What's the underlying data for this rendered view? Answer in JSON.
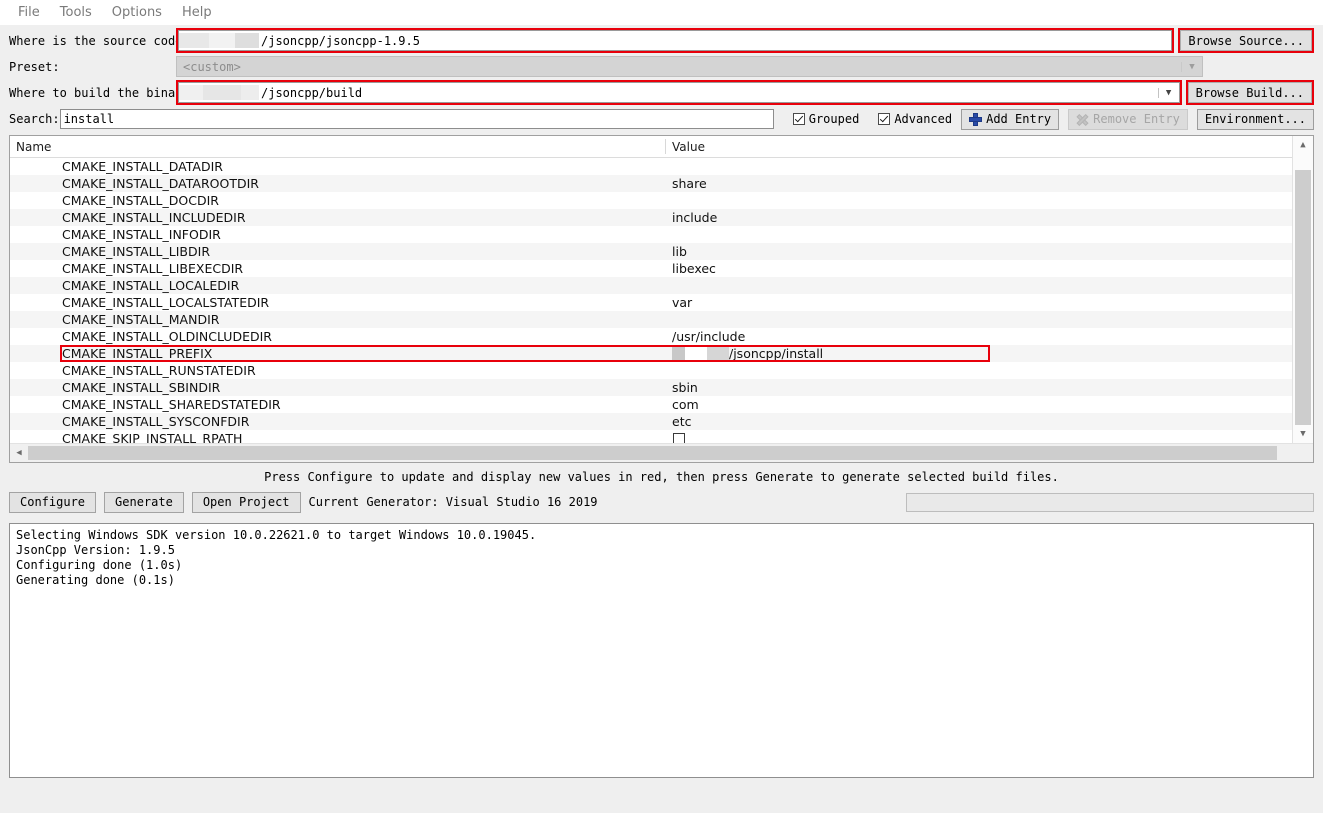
{
  "menubar": {
    "items": [
      {
        "label": "File"
      },
      {
        "label": "Tools"
      },
      {
        "label": "Options"
      },
      {
        "label": "Help"
      }
    ]
  },
  "form": {
    "source_label": "Where is the source code:",
    "source_value": "/jsoncpp/jsoncpp-1.9.5",
    "browse_source_label": "Browse Source...",
    "preset_label": "Preset:",
    "preset_value": "<custom>",
    "build_label": "Where to build the binaries:",
    "build_value": "/jsoncpp/build",
    "browse_build_label": "Browse Build..."
  },
  "search": {
    "label": "Search:",
    "value": "install",
    "placeholder": "",
    "grouped_label": "Grouped",
    "grouped_checked": true,
    "advanced_label": "Advanced",
    "advanced_checked": true,
    "add_entry_label": "Add Entry",
    "remove_entry_label": "Remove Entry",
    "environment_label": "Environment..."
  },
  "table": {
    "headers": {
      "name": "Name",
      "value": "Value"
    },
    "rows": [
      {
        "name": "CMAKE_INSTALL_DATADIR",
        "value": "",
        "type": "text"
      },
      {
        "name": "CMAKE_INSTALL_DATAROOTDIR",
        "value": "share",
        "type": "text"
      },
      {
        "name": "CMAKE_INSTALL_DOCDIR",
        "value": "",
        "type": "text"
      },
      {
        "name": "CMAKE_INSTALL_INCLUDEDIR",
        "value": "include",
        "type": "text"
      },
      {
        "name": "CMAKE_INSTALL_INFODIR",
        "value": "",
        "type": "text"
      },
      {
        "name": "CMAKE_INSTALL_LIBDIR",
        "value": "lib",
        "type": "text"
      },
      {
        "name": "CMAKE_INSTALL_LIBEXECDIR",
        "value": "libexec",
        "type": "text"
      },
      {
        "name": "CMAKE_INSTALL_LOCALEDIR",
        "value": "",
        "type": "text"
      },
      {
        "name": "CMAKE_INSTALL_LOCALSTATEDIR",
        "value": "var",
        "type": "text"
      },
      {
        "name": "CMAKE_INSTALL_MANDIR",
        "value": "",
        "type": "text"
      },
      {
        "name": "CMAKE_INSTALL_OLDINCLUDEDIR",
        "value": "/usr/include",
        "type": "text"
      },
      {
        "name": "CMAKE_INSTALL_PREFIX",
        "value": "/jsoncpp/install",
        "type": "editing"
      },
      {
        "name": "CMAKE_INSTALL_RUNSTATEDIR",
        "value": "",
        "type": "text"
      },
      {
        "name": "CMAKE_INSTALL_SBINDIR",
        "value": "sbin",
        "type": "text"
      },
      {
        "name": "CMAKE_INSTALL_SHAREDSTATEDIR",
        "value": "com",
        "type": "text"
      },
      {
        "name": "CMAKE_INSTALL_SYSCONFDIR",
        "value": "etc",
        "type": "text"
      },
      {
        "name": "CMAKE_SKIP_INSTALL_RPATH",
        "value": "",
        "type": "checkbox",
        "checked": false
      }
    ]
  },
  "hint": "Press Configure to update and display new values in red, then press Generate to generate selected build files.",
  "actions": {
    "configure_label": "Configure",
    "generate_label": "Generate",
    "open_project_label": "Open Project",
    "current_generator": "Current Generator: Visual Studio 16 2019"
  },
  "log": {
    "lines": [
      "Selecting Windows SDK version 10.0.22621.0 to target Windows 10.0.19045.",
      "JsonCpp Version: 1.9.5",
      "Configuring done (1.0s)",
      "Generating done (0.1s)"
    ]
  },
  "colors": {
    "highlight": "#e8000b",
    "accent": "#2a4ba8",
    "window_bg": "#efefef"
  }
}
